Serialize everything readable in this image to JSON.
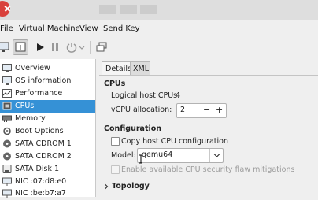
{
  "menubar": {
    "items": [
      "File",
      "Virtual Machine",
      "View",
      "Send Key"
    ]
  },
  "toolbar": {
    "buttons": [
      "console-monitor-icon",
      "details-info-icon",
      "run-icon",
      "pause-icon",
      "shutdown-icon",
      "dropdown-arrow-icon",
      "snapshots-icon"
    ]
  },
  "sidebar": {
    "items": [
      {
        "label": "Overview",
        "icon": "overview-icon"
      },
      {
        "label": "OS information",
        "icon": "os-info-icon"
      },
      {
        "label": "Performance",
        "icon": "performance-icon"
      },
      {
        "label": "CPUs",
        "icon": "cpu-icon",
        "selected": true
      },
      {
        "label": "Memory",
        "icon": "memory-icon"
      },
      {
        "label": "Boot Options",
        "icon": "boot-options-icon"
      },
      {
        "label": "SATA CDROM 1",
        "icon": "cdrom-icon"
      },
      {
        "label": "SATA CDROM 2",
        "icon": "cdrom-icon"
      },
      {
        "label": "SATA Disk 1",
        "icon": "disk-icon"
      },
      {
        "label": "NIC :07:d8:e0",
        "icon": "nic-icon"
      },
      {
        "label": "NIC :be:b7:a7",
        "icon": "nic-icon"
      }
    ]
  },
  "tabs": [
    {
      "label": "Details",
      "active": true
    },
    {
      "label": "XML",
      "active": false
    }
  ],
  "cpus": {
    "heading": "CPUs",
    "logical_label": "Logical host CPUs:",
    "logical_value": "4",
    "alloc_label": "vCPU allocation:",
    "alloc_value": "2",
    "minus": "−",
    "plus": "+"
  },
  "configuration": {
    "heading": "Configuration",
    "copy_host_label": "Copy host CPU configuration",
    "model_label": "Model:",
    "model_value": "qemu64",
    "flaw_label": "Enable available CPU security flaw mitigations"
  },
  "topology": {
    "label": "Topology"
  },
  "colors": {
    "selected_bg": "#3591d6",
    "close_button": "#d9413c"
  }
}
